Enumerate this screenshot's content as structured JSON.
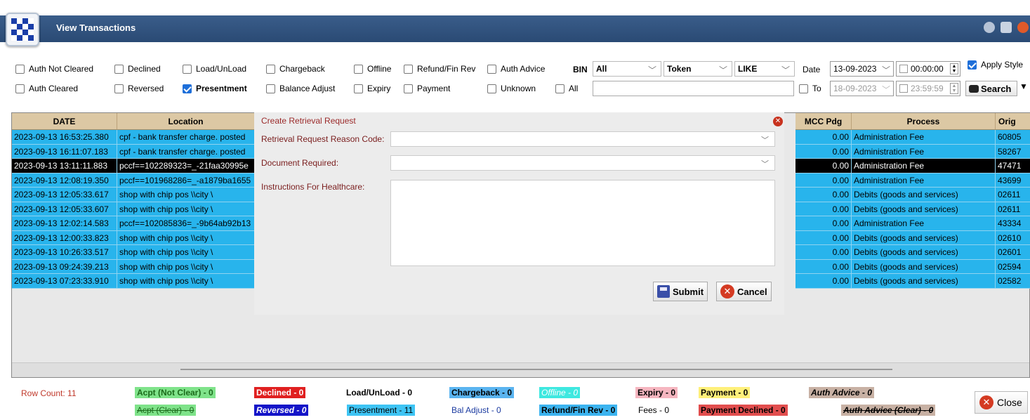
{
  "window": {
    "title": "View Transactions"
  },
  "filters": {
    "row1": [
      {
        "label": "Auth Not Cleared",
        "checked": false
      },
      {
        "label": "Declined",
        "checked": false
      },
      {
        "label": "Load/UnLoad",
        "checked": false
      },
      {
        "label": "Chargeback",
        "checked": false
      },
      {
        "label": "Offline",
        "checked": false
      },
      {
        "label": "Refund/Fin Rev",
        "checked": false
      },
      {
        "label": "Auth Advice",
        "checked": false
      }
    ],
    "row2": [
      {
        "label": "Auth Cleared",
        "checked": false
      },
      {
        "label": "Reversed",
        "checked": false
      },
      {
        "label": "Presentment",
        "checked": true
      },
      {
        "label": "Balance Adjust",
        "checked": false
      },
      {
        "label": "Expiry",
        "checked": false
      },
      {
        "label": "Payment",
        "checked": false
      },
      {
        "label": "Unknown",
        "checked": false
      },
      {
        "label": "All",
        "checked": false
      }
    ],
    "bin_label": "BIN",
    "bin_value": "All",
    "token_value": "Token",
    "like_value": "LIKE",
    "search_text": "",
    "date_label": "Date",
    "date_from": "13-09-2023",
    "time_from": "00:00:00",
    "to_label": "To",
    "date_to": "18-09-2023",
    "time_to": "23:59:59",
    "apply_style_label": "Apply Style",
    "apply_style_checked": true,
    "search_label": "Search"
  },
  "left_grid": {
    "columns": [
      "DATE",
      "Location"
    ],
    "rows": [
      {
        "date": "2023-09-13 16:53:25.380",
        "location": "cpf - bank transfer charge. posted",
        "selected": false
      },
      {
        "date": "2023-09-13 16:11:07.183",
        "location": "cpf - bank transfer charge. posted",
        "selected": false
      },
      {
        "date": "2023-09-13 13:11:11.883",
        "location": "pccf==102289323=_-21faa30995e",
        "selected": true
      },
      {
        "date": "2023-09-13 12:08:19.350",
        "location": "pccf==101968286=_-a1879ba1655",
        "selected": false
      },
      {
        "date": "2023-09-13 12:05:33.617",
        "location": "shop with chip pos   \\\\city      \\",
        "selected": false
      },
      {
        "date": "2023-09-13 12:05:33.607",
        "location": "shop with chip pos   \\\\city      \\",
        "selected": false
      },
      {
        "date": "2023-09-13 12:02:14.583",
        "location": "pccf==102085836=_-9b64ab92b13",
        "selected": false
      },
      {
        "date": "2023-09-13 12:00:33.823",
        "location": "shop with chip pos   \\\\city      \\",
        "selected": false
      },
      {
        "date": "2023-09-13 10:26:33.517",
        "location": "shop with chip pos   \\\\city      \\",
        "selected": false
      },
      {
        "date": "2023-09-13 09:24:39.213",
        "location": "shop with chip pos   \\\\city      \\",
        "selected": false
      },
      {
        "date": "2023-09-13 07:23:33.910",
        "location": "shop with chip pos   \\\\city      \\",
        "selected": false
      }
    ]
  },
  "right_grid": {
    "columns": [
      "MCC Pdg",
      "Process",
      "Orig"
    ],
    "rows": [
      {
        "mcc": "0.00",
        "process": "Administration Fee",
        "orig": "60805",
        "selected": false
      },
      {
        "mcc": "0.00",
        "process": "Administration Fee",
        "orig": "58267",
        "selected": false
      },
      {
        "mcc": "0.00",
        "process": "Administration Fee",
        "orig": "47471",
        "selected": true
      },
      {
        "mcc": "0.00",
        "process": "Administration Fee",
        "orig": "43699",
        "selected": false
      },
      {
        "mcc": "0.00",
        "process": "Debits (goods and services)",
        "orig": "02611",
        "selected": false
      },
      {
        "mcc": "0.00",
        "process": "Debits (goods and services)",
        "orig": "02611",
        "selected": false
      },
      {
        "mcc": "0.00",
        "process": "Administration Fee",
        "orig": "43334",
        "selected": false
      },
      {
        "mcc": "0.00",
        "process": "Debits (goods and services)",
        "orig": "02610",
        "selected": false
      },
      {
        "mcc": "0.00",
        "process": "Debits (goods and services)",
        "orig": "02601",
        "selected": false
      },
      {
        "mcc": "0.00",
        "process": "Debits (goods and services)",
        "orig": "02594",
        "selected": false
      },
      {
        "mcc": "0.00",
        "process": "Debits (goods and services)",
        "orig": "02582",
        "selected": false
      }
    ]
  },
  "modal": {
    "title": "Create Retrieval Request",
    "reason_label": "Retrieval Request Reason Code:",
    "reason_value": "",
    "document_label": "Document Required:",
    "document_value": "",
    "instructions_label": "Instructions For Healthcare:",
    "instructions_value": "",
    "submit_label": "Submit",
    "cancel_label": "Cancel"
  },
  "footer": {
    "row_count": "Row Count: 11",
    "legend_row1": [
      {
        "label": "Acpt (Not Clear) - 0",
        "bg": "#7fe38a",
        "color": "#1b6b1b",
        "bold": true,
        "italic": false,
        "strike": false
      },
      {
        "label": "Declined - 0",
        "bg": "#e02020",
        "color": "#ffffff",
        "bold": true,
        "italic": false,
        "strike": false
      },
      {
        "label": "Load/UnLoad - 0",
        "bg": "#ffffff",
        "color": "#000000",
        "bold": true,
        "italic": false,
        "strike": false
      },
      {
        "label": "Chargeback - 0",
        "bg": "#5ab4f0",
        "color": "#000000",
        "bold": true,
        "italic": false,
        "strike": false
      },
      {
        "label": "Offline - 0",
        "bg": "#3ee8e0",
        "color": "#ffffff",
        "bold": false,
        "italic": true,
        "strike": false
      },
      {
        "label": "Expiry - 0",
        "bg": "#f6b6c0",
        "color": "#000000",
        "bold": true,
        "italic": false,
        "strike": false
      },
      {
        "label": "Payment - 0",
        "bg": "#fff07a",
        "color": "#000000",
        "bold": true,
        "italic": false,
        "strike": false
      },
      {
        "label": "Auth Advice - 0",
        "bg": "#c8b1a4",
        "color": "#000000",
        "bold": true,
        "italic": true,
        "strike": false
      }
    ],
    "legend_row2": [
      {
        "label": "Acpt (Clear) - 0",
        "bg": "#7fe38a",
        "color": "#1b6b1b",
        "bold": false,
        "italic": false,
        "strike": true
      },
      {
        "label": "Reversed - 0",
        "bg": "#1414c8",
        "color": "#ffffff",
        "bold": true,
        "italic": true,
        "strike": false
      },
      {
        "label": "Presentment - 11",
        "bg": "#3ec4f4",
        "color": "#000000",
        "bold": false,
        "italic": false,
        "strike": false
      },
      {
        "label": "Bal Adjust - 0",
        "bg": "#ffffff",
        "color": "#1a3aa0",
        "bold": false,
        "italic": false,
        "strike": false
      },
      {
        "label": "Refund/Fin Rev - 0",
        "bg": "#3cb4f0",
        "color": "#000000",
        "bold": true,
        "italic": false,
        "strike": false
      },
      {
        "label": "Fees - 0",
        "bg": "#ffffff",
        "color": "#000000",
        "bold": false,
        "italic": false,
        "strike": false
      },
      {
        "label": "Payment Declined - 0",
        "bg": "#e24e4e",
        "color": "#000000",
        "bold": true,
        "italic": false,
        "strike": false
      },
      {
        "label": "Auth Advice (Clear) - 0",
        "bg": "#c8b1a4",
        "color": "#000000",
        "bold": true,
        "italic": true,
        "strike": true
      }
    ],
    "close_label": "Close"
  }
}
